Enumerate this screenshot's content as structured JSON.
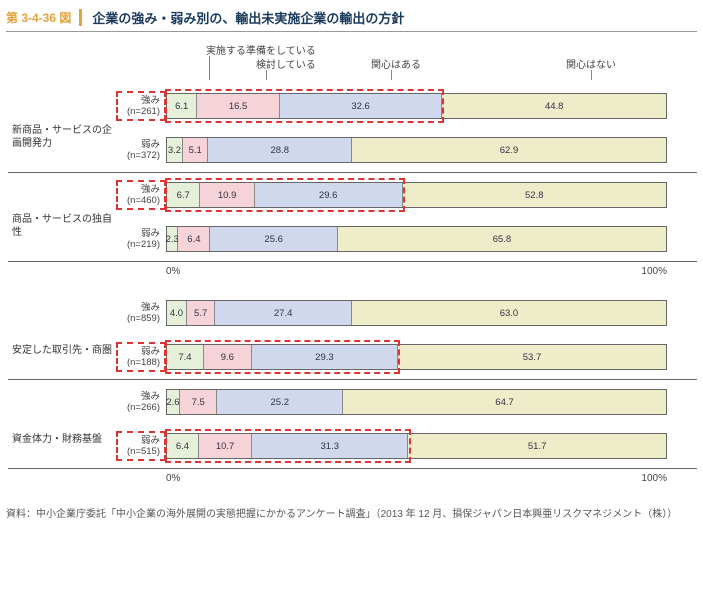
{
  "figure_number": "第 3-4-36 図",
  "figure_title": "企業の強み・弱み別の、輸出未実施企業の輸出の方針",
  "legend": {
    "seg0": "実施する準備をしている",
    "seg1": "検討している",
    "seg2": "関心はある",
    "seg3": "関心はない"
  },
  "axis": {
    "start": "0%",
    "end": "100%"
  },
  "groups": [
    {
      "category": "新商品・サービスの企画開発力",
      "rows": [
        {
          "label_top": "強み",
          "label_bottom": "(n=261)",
          "highlight": true,
          "v": [
            6.1,
            16.5,
            32.6,
            44.8
          ]
        },
        {
          "label_top": "弱み",
          "label_bottom": "(n=372)",
          "highlight": false,
          "v": [
            3.2,
            5.1,
            28.8,
            62.9
          ]
        }
      ]
    },
    {
      "category": "商品・サービスの独自性",
      "rows": [
        {
          "label_top": "強み",
          "label_bottom": "(n=460)",
          "highlight": true,
          "v": [
            6.7,
            10.9,
            29.6,
            52.8
          ]
        },
        {
          "label_top": "弱み",
          "label_bottom": "(n=219)",
          "highlight": false,
          "v": [
            2.3,
            6.4,
            25.6,
            65.8
          ]
        }
      ]
    },
    {
      "category": "安定した取引先・商圏",
      "rows": [
        {
          "label_top": "強み",
          "label_bottom": "(n=859)",
          "highlight": false,
          "v": [
            4.0,
            5.7,
            27.4,
            63.0
          ]
        },
        {
          "label_top": "弱み",
          "label_bottom": "(n=188)",
          "highlight": true,
          "v": [
            7.4,
            9.6,
            29.3,
            53.7
          ]
        }
      ]
    },
    {
      "category": "資金体力・財務基盤",
      "rows": [
        {
          "label_top": "強み",
          "label_bottom": "(n=266)",
          "highlight": false,
          "v": [
            2.6,
            7.5,
            25.2,
            64.7
          ]
        },
        {
          "label_top": "弱み",
          "label_bottom": "(n=515)",
          "highlight": true,
          "v": [
            6.4,
            10.7,
            31.3,
            51.7
          ]
        }
      ]
    }
  ],
  "source": "資料：中小企業庁委託「中小企業の海外展開の実態把握にかかるアンケート調査」（2013 年 12 月、損保ジャパン日本興亜リスクマネジメント（株））",
  "chart_data": {
    "type": "bar",
    "stacked": true,
    "orientation": "horizontal",
    "unit": "percent",
    "title": "企業の強み・弱み別の、輸出未実施企業の輸出の方針",
    "xlabel": "",
    "ylabel": "",
    "xlim": [
      0,
      100
    ],
    "series_names": [
      "実施する準備をしている",
      "検討している",
      "関心はある",
      "関心はない"
    ],
    "categories": [
      "新商品・サービスの企画開発力 / 強み (n=261)",
      "新商品・サービスの企画開発力 / 弱み (n=372)",
      "商品・サービスの独自性 / 強み (n=460)",
      "商品・サービスの独自性 / 弱み (n=219)",
      "安定した取引先・商圏 / 強み (n=859)",
      "安定した取引先・商圏 / 弱み (n=188)",
      "資金体力・財務基盤 / 強み (n=266)",
      "資金体力・財務基盤 / 弱み (n=515)"
    ],
    "series": [
      {
        "name": "実施する準備をしている",
        "values": [
          6.1,
          3.2,
          6.7,
          2.3,
          4.0,
          7.4,
          2.6,
          6.4
        ]
      },
      {
        "name": "検討している",
        "values": [
          16.5,
          5.1,
          10.9,
          6.4,
          5.7,
          9.6,
          7.5,
          10.7
        ]
      },
      {
        "name": "関心はある",
        "values": [
          32.6,
          28.8,
          29.6,
          25.6,
          27.4,
          29.3,
          25.2,
          31.3
        ]
      },
      {
        "name": "関心はない",
        "values": [
          44.8,
          62.9,
          52.8,
          65.8,
          63.0,
          53.7,
          64.7,
          51.7
        ]
      }
    ],
    "highlighted_rows": [
      0,
      2,
      5,
      7
    ]
  }
}
